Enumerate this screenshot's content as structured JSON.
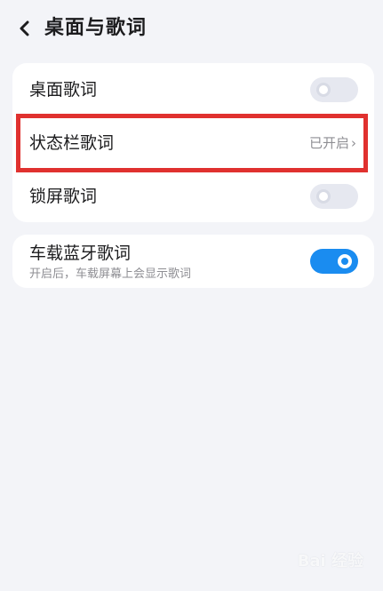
{
  "header": {
    "back_icon": "chevron-left-icon",
    "title": "桌面与歌词"
  },
  "settings": {
    "desktop_lyrics": {
      "label": "桌面歌词",
      "enabled": false
    },
    "statusbar_lyrics": {
      "label": "状态栏歌词",
      "value": "已开启",
      "chevron": "›"
    },
    "lockscreen_lyrics": {
      "label": "锁屏歌词",
      "enabled": false
    },
    "car_bluetooth_lyrics": {
      "label": "车载蓝牙歌词",
      "description": "开启后，车载屏幕上会显示歌词",
      "enabled": true
    }
  },
  "watermark": "Bai 经验",
  "colors": {
    "accent": "#1a8cf0",
    "highlight_box": "#e0312f",
    "background": "#f3f4f8"
  }
}
